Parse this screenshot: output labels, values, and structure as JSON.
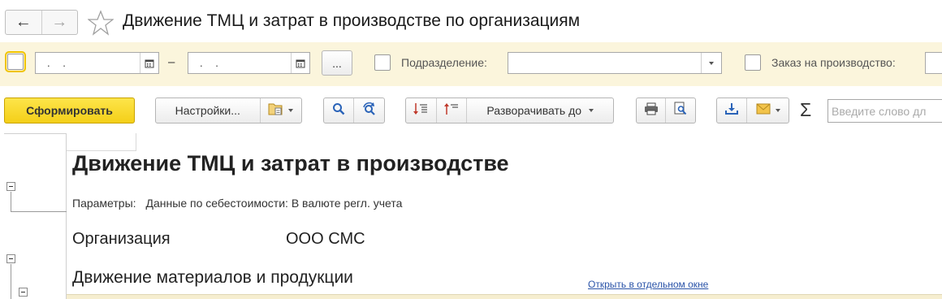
{
  "window": {
    "title": "Движение ТМЦ и затрат в производстве по организациям"
  },
  "filters": {
    "date_from": ".  .",
    "date_to": ".  .",
    "dash": "–",
    "more_button": "...",
    "division_label": "Подразделение:",
    "division_value": "",
    "order_label": "Заказ на производство:",
    "order_value": ""
  },
  "toolbar": {
    "generate": "Сформировать",
    "settings": "Настройки...",
    "expand_to": "Разворачивать до",
    "sigma": "Σ",
    "search_placeholder": "Введите слово дл"
  },
  "report": {
    "title": "Движение ТМЦ и затрат в производстве",
    "params_label": "Параметры:",
    "params_value": "Данные по себестоимости: В валюте регл. учета",
    "org_label": "Организация",
    "org_value": "ООО СМС",
    "section_title": "Движение материалов и продукции",
    "open_link": "Открыть в отдельном окне"
  },
  "colors": {
    "accent_yellow": "#f4cf18",
    "filter_bg": "#fbf5dc",
    "link_blue": "#2a53a8"
  }
}
